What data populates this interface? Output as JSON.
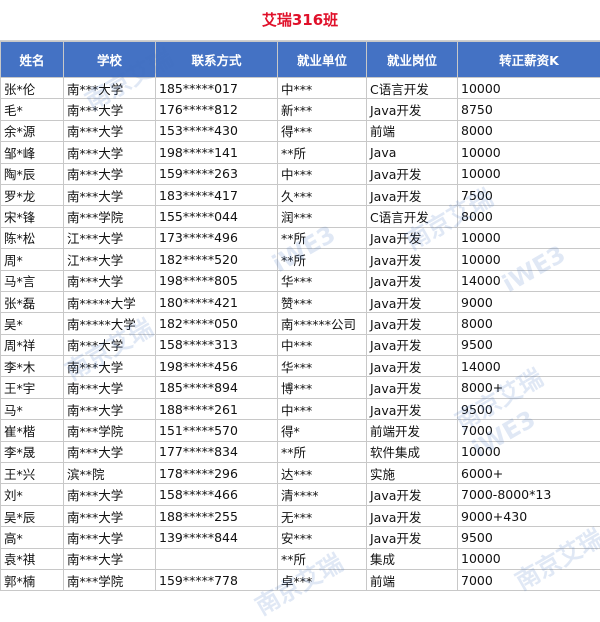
{
  "title": "艾瑞316班",
  "watermark": "南京艾瑞",
  "watermark_alt": "iWE3",
  "columns": [
    "姓名",
    "学校",
    "联系方式",
    "就业单位",
    "就业岗位",
    "转正薪资K"
  ],
  "rows": [
    [
      "张*伦",
      "南***大学",
      "185*****017",
      "中***",
      "C语言开发",
      "10000"
    ],
    [
      "毛*",
      "南***大学",
      "176*****812",
      "新***",
      "Java开发",
      "8750"
    ],
    [
      "余*源",
      "南***大学",
      "153*****430",
      "得***",
      "前端",
      "8000"
    ],
    [
      "邹*峰",
      "南***大学",
      "198*****141",
      "**所",
      "Java",
      "10000"
    ],
    [
      "陶*辰",
      "南***大学",
      "159*****263",
      "中***",
      "Java开发",
      "10000"
    ],
    [
      "罗*龙",
      "南***大学",
      "183*****417",
      "久***",
      "Java开发",
      "7500"
    ],
    [
      "宋*锋",
      "南***学院",
      "155*****044",
      "润***",
      "C语言开发",
      "8000"
    ],
    [
      "陈*松",
      "江***大学",
      "173*****496",
      "**所",
      "Java开发",
      "10000"
    ],
    [
      "周*",
      "江***大学",
      "182*****520",
      "**所",
      "Java开发",
      "10000"
    ],
    [
      "马*言",
      "南***大学",
      "198*****805",
      "华***",
      "Java开发",
      "14000"
    ],
    [
      "张*磊",
      "南*****大学",
      "180*****421",
      "赞***",
      "Java开发",
      "9000"
    ],
    [
      "吴*",
      "南*****大学",
      "182*****050",
      "南******公司",
      "Java开发",
      "8000"
    ],
    [
      "周*祥",
      "南***大学",
      "158*****313",
      "中***",
      "Java开发",
      "9500"
    ],
    [
      "李*木",
      "南***大学",
      "198*****456",
      "华***",
      "Java开发",
      "14000"
    ],
    [
      "王*宇",
      "南***大学",
      "185*****894",
      "博***",
      "Java开发",
      "8000+"
    ],
    [
      "马*",
      "南***大学",
      "188*****261",
      "中***",
      "Java开发",
      "9500"
    ],
    [
      "崔*楷",
      "南***学院",
      "151*****570",
      "得*",
      "前端开发",
      "7000"
    ],
    [
      "李*晟",
      "南***大学",
      "177*****834",
      "**所",
      "软件集成",
      "10000"
    ],
    [
      "王*兴",
      "滨**院",
      "178*****296",
      "达***",
      "实施",
      "6000+"
    ],
    [
      "刘*",
      "南***大学",
      "158*****466",
      "清****",
      "Java开发",
      "7000-8000*13"
    ],
    [
      "吴*辰",
      "南***大学",
      "188*****255",
      "无***",
      "Java开发",
      "9000+430"
    ],
    [
      "高*",
      "南***大学",
      "139*****844",
      "安***",
      "Java开发",
      "9500"
    ],
    [
      "袁*祺",
      "南***大学",
      "",
      "**所",
      "集成",
      "10000"
    ],
    [
      "郭*楠",
      "南***学院",
      "159*****778",
      "卓***",
      "前端",
      "7000"
    ]
  ]
}
